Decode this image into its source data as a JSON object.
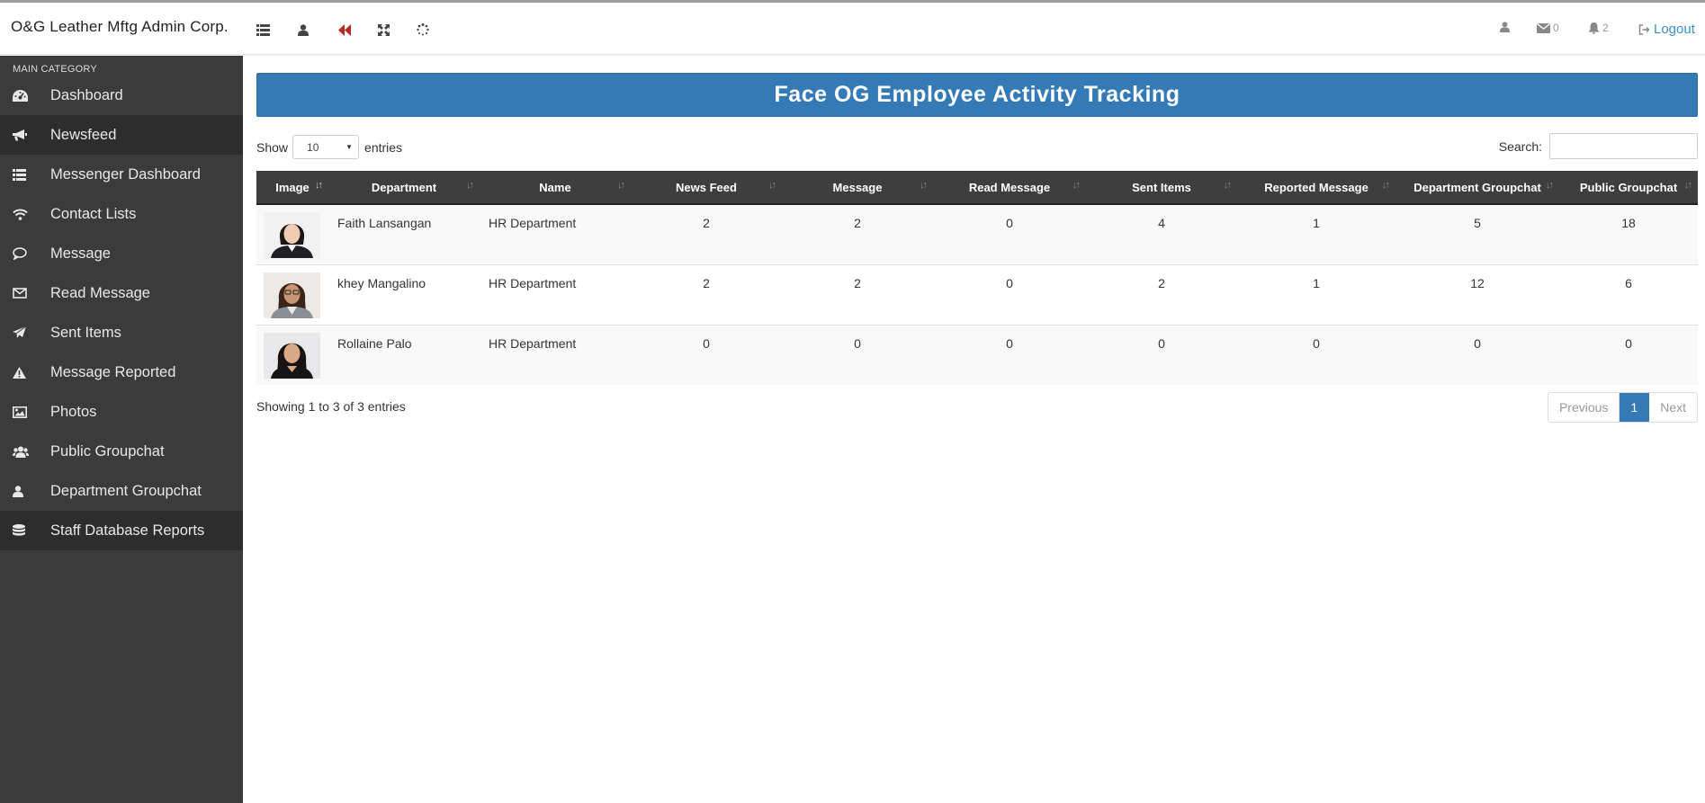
{
  "brand": "O&G Leather Mftg Admin Corp.",
  "topbar": {
    "messages_count": "0",
    "notifications_count": "2",
    "logout_label": "Logout"
  },
  "sidebar": {
    "category": "MAIN CATEGORY",
    "items": [
      {
        "label": "Dashboard",
        "icon": "dashboard-icon"
      },
      {
        "label": "Newsfeed",
        "icon": "bullhorn-icon"
      },
      {
        "label": "Messenger Dashboard",
        "icon": "list-icon"
      },
      {
        "label": "Contact Lists",
        "icon": "wifi-icon"
      },
      {
        "label": "Message",
        "icon": "comment-icon"
      },
      {
        "label": "Read Message",
        "icon": "envelope-icon"
      },
      {
        "label": "Sent Items",
        "icon": "paper-plane-icon"
      },
      {
        "label": "Message Reported",
        "icon": "warning-icon"
      },
      {
        "label": "Photos",
        "icon": "image-icon"
      },
      {
        "label": "Public Groupchat",
        "icon": "users-icon"
      },
      {
        "label": "Department Groupchat",
        "icon": "user-icon"
      },
      {
        "label": "Staff Database Reports",
        "icon": "database-icon"
      }
    ]
  },
  "main": {
    "title": "Face OG Employee Activity Tracking",
    "show_label": "Show",
    "entries_value": "10",
    "entries_label": "entries",
    "search_label": "Search:",
    "columns": [
      "Image",
      "Department",
      "Name",
      "News Feed",
      "Message",
      "Read Message",
      "Sent Items",
      "Reported Message",
      "Department Groupchat",
      "Public Groupchat"
    ],
    "rows": [
      {
        "department": "Faith  Lansangan",
        "name": "HR Department",
        "news_feed": "2",
        "message": "2",
        "read_message": "0",
        "sent_items": "4",
        "reported_message": "1",
        "department_groupchat": "5",
        "public_groupchat": "18"
      },
      {
        "department": "khey  Mangalino",
        "name": "HR Department",
        "news_feed": "2",
        "message": "2",
        "read_message": "0",
        "sent_items": "2",
        "reported_message": "1",
        "department_groupchat": "12",
        "public_groupchat": "6"
      },
      {
        "department": "Rollaine  Palo",
        "name": "HR Department",
        "news_feed": "0",
        "message": "0",
        "read_message": "0",
        "sent_items": "0",
        "reported_message": "0",
        "department_groupchat": "0",
        "public_groupchat": "0"
      }
    ],
    "info": "Showing 1 to 3 of 3 entries",
    "pager": {
      "previous": "Previous",
      "current": "1",
      "next": "Next"
    }
  }
}
